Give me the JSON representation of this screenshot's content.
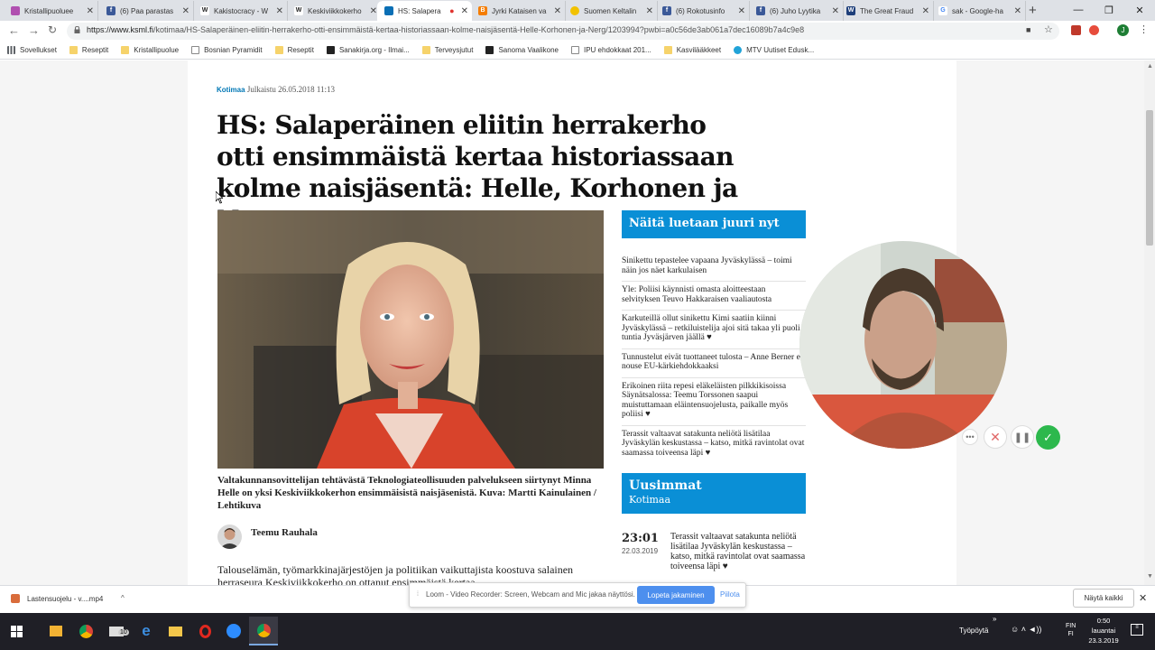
{
  "tabs": [
    {
      "title": "Kristallipuoluee",
      "favicon_color": "#b04fb0",
      "favicon_glyph": ""
    },
    {
      "title": "(6) Paa parastas",
      "favicon_color": "#3b5998",
      "favicon_glyph": "f"
    },
    {
      "title": "Kakistocracy - W",
      "favicon_color": "#ffffff",
      "favicon_glyph": "W"
    },
    {
      "title": "Keskiviikkokerho",
      "favicon_color": "#ffffff",
      "favicon_glyph": "W"
    },
    {
      "title": "HS: Salapera",
      "favicon_color": "#0a6fb5",
      "favicon_glyph": "",
      "active": true
    },
    {
      "title": "Jyrki Kataisen va",
      "favicon_color": "#f57d00",
      "favicon_glyph": "B"
    },
    {
      "title": "Suomen Keltalin",
      "favicon_color": "#f2c200",
      "favicon_glyph": ""
    },
    {
      "title": "(6) Rokotusinfo",
      "favicon_color": "#3b5998",
      "favicon_glyph": "f"
    },
    {
      "title": "(6) Juho Lyytika",
      "favicon_color": "#3b5998",
      "favicon_glyph": "f"
    },
    {
      "title": "The Great Fraud",
      "favicon_color": "#1e3f7a",
      "favicon_glyph": "W"
    },
    {
      "title": "sak - Google-ha",
      "favicon_color": "#4285f4",
      "favicon_glyph": "G"
    }
  ],
  "address": {
    "url_prefix": "https://www.ksml.fi",
    "url_rest": "/kotimaa/HS-Salaperäinen-eliitin-herrakerho-otti-ensimmäistä-kertaa-historiassaan-kolme-naisjäsentä-Helle-Korhonen-ja-Nerg/1203994?pwbi=a0c56de3ab061a7dec16089b7a4c9e8"
  },
  "bookmarks": [
    {
      "label": "Sovellukset",
      "color": "#5f6368"
    },
    {
      "label": "Reseptit",
      "color": "#f6d36b"
    },
    {
      "label": "Kristallipuolue",
      "color": "#f6d36b"
    },
    {
      "label": "Bosnian Pyramidit",
      "color": "#ffffff"
    },
    {
      "label": "Reseptit",
      "color": "#f6d36b"
    },
    {
      "label": "Sanakirja.org - Ilmai...",
      "color": "#222222"
    },
    {
      "label": "Terveysjutut",
      "color": "#f6d36b"
    },
    {
      "label": "Sanoma Vaalikone",
      "color": "#222222"
    },
    {
      "label": "IPU ehdokkaat 201...",
      "color": "#ffffff"
    },
    {
      "label": "Kasvilääkkeet",
      "color": "#f6d36b"
    },
    {
      "label": "MTV Uutiset Edusk...",
      "color": "#21a3d8"
    }
  ],
  "article": {
    "category": "Kotimaa",
    "published": "Julkaistu 26.05.2018 11:13",
    "headline": "HS: Salaperäinen eliitin herrakerho otti ensimmäistä kertaa historiassaan kolme naisjäsentä: Helle, Korhonen ja Nerg",
    "caption": "Valtakunnansovittelijan tehtävästä Teknologiateollisuuden palvelukseen siirtynyt Minna Helle on yksi Keskiviikkokerhon ensimmäisistä naisjäsenistä. Kuva: Martti Kainulainen / Lehtikuva",
    "author": "Teemu Rauhala",
    "lead": "Talouselämän, työmarkkinajärjestöjen ja politiikan vaikuttajista koostuva salainen herraseura Keskiviikkokerho on ottanut ensimmäistä kertaa"
  },
  "most_read": {
    "title": "Näitä luetaan juuri nyt",
    "items": [
      "Sinikettu tepastelee vapaana Jyväskylässä – toimi näin jos näet karkulaisen",
      "Yle: Poliisi käynnisti omasta aloitteestaan selvityksen Teuvo Hakkaraisen vaaliautosta",
      "Karkuteillä ollut sinikettu Kimi saatiin kiinni Jyväskylässä – retkiluistelija ajoi sitä takaa yli puoli tuntia Jyväsjärven jäällä ♥",
      "Tunnustelut eivät tuottaneet tulosta – Anne Berner ei nouse EU-kärkiehdokkaaksi",
      "Erikoinen riita repesi eläkeläisten pilkkikisoissa Säynätsalossa: Teemu Torssonen saapui muistuttamaan eläintensuojelusta, paikalle myös poliisi ♥",
      "Terassit valtaavat satakunta neliötä lisätilaa Jyväskylän keskustassa – katso, mitkä ravintolat ovat saamassa toiveensa läpi ♥"
    ]
  },
  "latest": {
    "title": "Uusimmat",
    "subtitle": "Kotimaa",
    "time": "23:01",
    "date": "22.03.2019",
    "text": "Terassit valtaavat satakunta neliötä lisätilaa Jyväskylän keskustassa – katso, mitkä ravintolat ovat saamassa toiveensa läpi ♥"
  },
  "download": {
    "file": "Lastensuojelu - v....mp4",
    "show_all": "Näytä kaikki"
  },
  "loom": {
    "text": "Loom - Video Recorder: Screen, Webcam and Mic jakaa näyttösi.",
    "stop": "Lopeta jakaminen",
    "hide": "Piilota"
  },
  "taskbar": {
    "workspace": "Työpöytä",
    "lang_top": "FIN",
    "lang_bottom": "FI",
    "time": "0:50",
    "day": "lauantai",
    "date": "23.3.2019",
    "mail_badge": "10"
  },
  "colors": {
    "accent_blue": "#0a8fd6",
    "category_blue": "#0077b5",
    "loom_blue": "#4d8fee",
    "done_green": "#2db84d"
  }
}
